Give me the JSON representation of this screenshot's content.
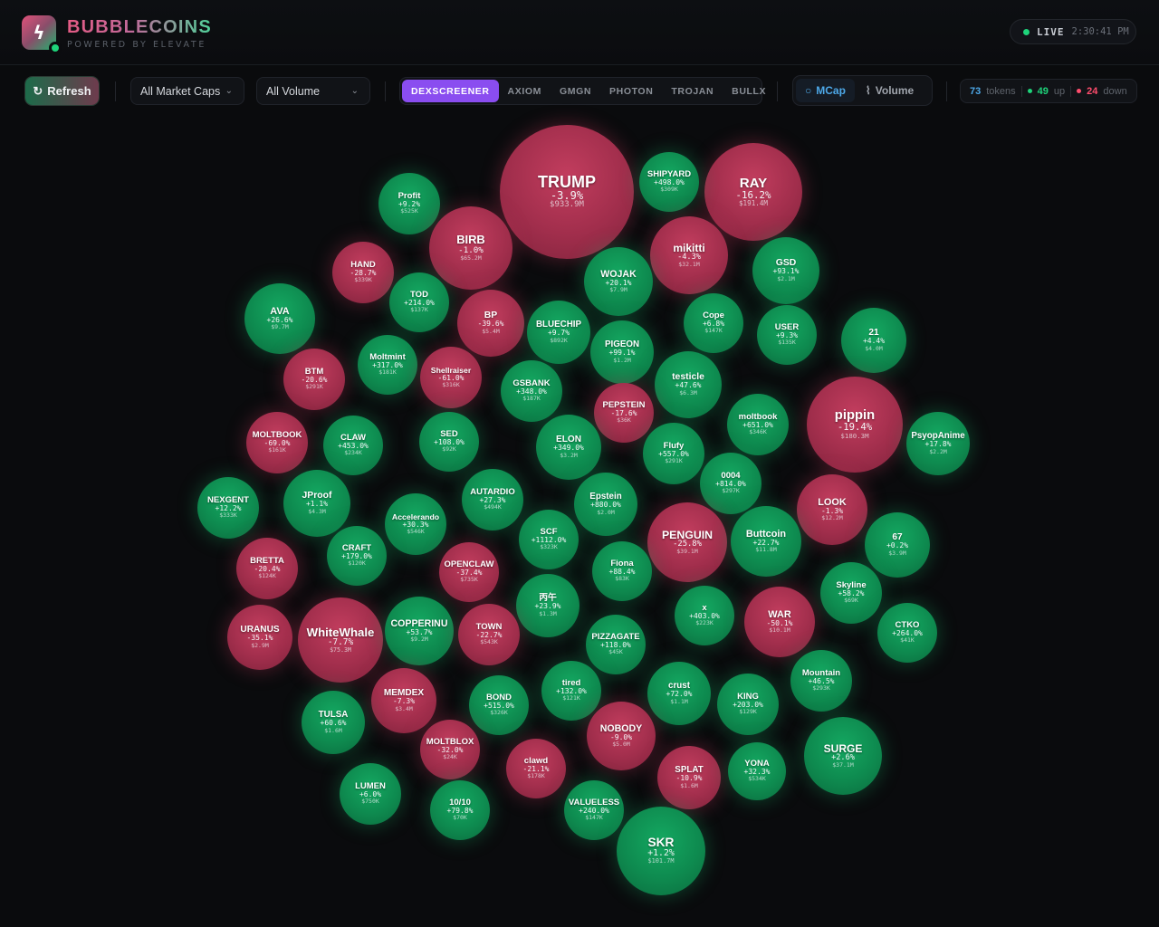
{
  "header": {
    "brand": "BUBBLECOINS",
    "powered_by": "POWERED BY ELEVATE",
    "live_label": "LIVE",
    "live_time": "2:30:41 PM"
  },
  "toolbar": {
    "refresh_label": "Refresh",
    "market_cap_filter": "All Market Caps",
    "volume_filter": "All Volume",
    "platforms": [
      {
        "label": "DEXSCREENER",
        "active": true
      },
      {
        "label": "AXIOM",
        "active": false
      },
      {
        "label": "GMGN",
        "active": false
      },
      {
        "label": "PHOTON",
        "active": false
      },
      {
        "label": "TROJAN",
        "active": false
      },
      {
        "label": "BULLX",
        "active": false
      }
    ],
    "metrics": [
      {
        "label": "MCap",
        "active": true,
        "icon": "circle-icon"
      },
      {
        "label": "Volume",
        "active": false,
        "icon": "pulse-icon"
      }
    ]
  },
  "stats": {
    "tokens": "73",
    "tokens_label": "tokens",
    "up": "49",
    "up_label": "up",
    "down": "24",
    "down_label": "down"
  },
  "colors": {
    "up": "#0e8a4f",
    "down": "#a12e4c",
    "accent_purple": "#8a4df0",
    "accent_blue": "#4da8e8",
    "stat_up": "#1ed37a",
    "stat_down": "#ff4d6d"
  },
  "bubbles": [
    {
      "symbol": "TRUMP",
      "change": "-3.9%",
      "mcap": "$933.9M",
      "dir": "down"
    },
    {
      "symbol": "RAY",
      "change": "-16.2%",
      "mcap": "$191.4M",
      "dir": "down"
    },
    {
      "symbol": "SHIPYARD",
      "change": "+498.0%",
      "mcap": "$309K",
      "dir": "up"
    },
    {
      "symbol": "Profit",
      "change": "+9.2%",
      "mcap": "$525K",
      "dir": "up"
    },
    {
      "symbol": "BIRB",
      "change": "-1.0%",
      "mcap": "$65.2M",
      "dir": "down"
    },
    {
      "symbol": "mikitti",
      "change": "-4.3%",
      "mcap": "$32.1M",
      "dir": "down"
    },
    {
      "symbol": "GSD",
      "change": "+93.1%",
      "mcap": "$2.1M",
      "dir": "up"
    },
    {
      "symbol": "HAND",
      "change": "-28.7%",
      "mcap": "$339K",
      "dir": "down"
    },
    {
      "symbol": "WOJAK",
      "change": "+20.1%",
      "mcap": "$7.9M",
      "dir": "up"
    },
    {
      "symbol": "TOD",
      "change": "+214.0%",
      "mcap": "$137K",
      "dir": "up"
    },
    {
      "symbol": "AVA",
      "change": "+26.6%",
      "mcap": "$9.7M",
      "dir": "up"
    },
    {
      "symbol": "BP",
      "change": "-39.6%",
      "mcap": "$5.4M",
      "dir": "down"
    },
    {
      "symbol": "BLUECHIP",
      "change": "+9.7%",
      "mcap": "$892K",
      "dir": "up"
    },
    {
      "symbol": "Cope",
      "change": "+6.8%",
      "mcap": "$147K",
      "dir": "up"
    },
    {
      "symbol": "USER",
      "change": "+9.3%",
      "mcap": "$135K",
      "dir": "up"
    },
    {
      "symbol": "21",
      "change": "+4.4%",
      "mcap": "$4.0M",
      "dir": "up"
    },
    {
      "symbol": "PIGEON",
      "change": "+99.1%",
      "mcap": "$1.2M",
      "dir": "up"
    },
    {
      "symbol": "Moltmint",
      "change": "+317.0%",
      "mcap": "$181K",
      "dir": "up"
    },
    {
      "symbol": "BTM",
      "change": "-20.6%",
      "mcap": "$291K",
      "dir": "down"
    },
    {
      "symbol": "Shellraiser",
      "change": "-61.0%",
      "mcap": "$316K",
      "dir": "down"
    },
    {
      "symbol": "testicle",
      "change": "+47.6%",
      "mcap": "$6.3M",
      "dir": "up"
    },
    {
      "symbol": "GSBANK",
      "change": "+348.0%",
      "mcap": "$187K",
      "dir": "up"
    },
    {
      "symbol": "PEPSTEIN",
      "change": "-17.6%",
      "mcap": "$36K",
      "dir": "down"
    },
    {
      "symbol": "pippin",
      "change": "-19.4%",
      "mcap": "$180.3M",
      "dir": "down"
    },
    {
      "symbol": "moltbook",
      "change": "+651.0%",
      "mcap": "$346K",
      "dir": "up"
    },
    {
      "symbol": "PsyopAnime",
      "change": "+17.8%",
      "mcap": "$2.2M",
      "dir": "up"
    },
    {
      "symbol": "MOLTBOOK",
      "change": "-69.0%",
      "mcap": "$161K",
      "dir": "down"
    },
    {
      "symbol": "CLAW",
      "change": "+453.0%",
      "mcap": "$234K",
      "dir": "up"
    },
    {
      "symbol": "SED",
      "change": "+108.0%",
      "mcap": "$92K",
      "dir": "up"
    },
    {
      "symbol": "ELON",
      "change": "+349.0%",
      "mcap": "$3.2M",
      "dir": "up"
    },
    {
      "symbol": "Flufy",
      "change": "+557.0%",
      "mcap": "$291K",
      "dir": "up"
    },
    {
      "symbol": "0004",
      "change": "+814.0%",
      "mcap": "$297K",
      "dir": "up"
    },
    {
      "symbol": "NEXGENT",
      "change": "+12.2%",
      "mcap": "$333K",
      "dir": "up"
    },
    {
      "symbol": "JProof",
      "change": "+1.1%",
      "mcap": "$4.3M",
      "dir": "up"
    },
    {
      "symbol": "AUTARDIO",
      "change": "+27.3%",
      "mcap": "$494K",
      "dir": "up"
    },
    {
      "symbol": "Epstein",
      "change": "+880.0%",
      "mcap": "$2.0M",
      "dir": "up"
    },
    {
      "symbol": "LOOK",
      "change": "-1.3%",
      "mcap": "$12.2M",
      "dir": "down"
    },
    {
      "symbol": "Accelerando",
      "change": "+30.3%",
      "mcap": "$546K",
      "dir": "up"
    },
    {
      "symbol": "SCF",
      "change": "+1112.0%",
      "mcap": "$323K",
      "dir": "up"
    },
    {
      "symbol": "PENGUIN",
      "change": "-25.8%",
      "mcap": "$39.1M",
      "dir": "down"
    },
    {
      "symbol": "Buttcoin",
      "change": "+22.7%",
      "mcap": "$11.8M",
      "dir": "up"
    },
    {
      "symbol": "67",
      "change": "+0.2%",
      "mcap": "$3.9M",
      "dir": "up"
    },
    {
      "symbol": "BRETTA",
      "change": "-20.4%",
      "mcap": "$124K",
      "dir": "down"
    },
    {
      "symbol": "CRAFT",
      "change": "+179.0%",
      "mcap": "$120K",
      "dir": "up"
    },
    {
      "symbol": "OPENCLAW",
      "change": "-37.4%",
      "mcap": "$735K",
      "dir": "down"
    },
    {
      "symbol": "Fiona",
      "change": "+88.4%",
      "mcap": "$83K",
      "dir": "up"
    },
    {
      "symbol": "Skyline",
      "change": "+58.2%",
      "mcap": "$69K",
      "dir": "up"
    },
    {
      "symbol": "丙午",
      "change": "+23.9%",
      "mcap": "$1.3M",
      "dir": "up"
    },
    {
      "symbol": "URANUS",
      "change": "-35.1%",
      "mcap": "$2.9M",
      "dir": "down"
    },
    {
      "symbol": "WhiteWhale",
      "change": "-7.7%",
      "mcap": "$75.3M",
      "dir": "down"
    },
    {
      "symbol": "COPPERINU",
      "change": "+53.7%",
      "mcap": "$9.2M",
      "dir": "up"
    },
    {
      "symbol": "TOWN",
      "change": "-22.7%",
      "mcap": "$543K",
      "dir": "down"
    },
    {
      "symbol": "PIZZAGATE",
      "change": "+118.0%",
      "mcap": "$45K",
      "dir": "up"
    },
    {
      "symbol": "x",
      "change": "+403.0%",
      "mcap": "$223K",
      "dir": "up"
    },
    {
      "symbol": "WAR",
      "change": "-50.1%",
      "mcap": "$10.1M",
      "dir": "down"
    },
    {
      "symbol": "CTKO",
      "change": "+264.0%",
      "mcap": "$41K",
      "dir": "up"
    },
    {
      "symbol": "Mountain",
      "change": "+46.5%",
      "mcap": "$293K",
      "dir": "up"
    },
    {
      "symbol": "MEMDEX",
      "change": "-7.3%",
      "mcap": "$3.4M",
      "dir": "down"
    },
    {
      "symbol": "tired",
      "change": "+132.0%",
      "mcap": "$121K",
      "dir": "up"
    },
    {
      "symbol": "crust",
      "change": "+72.0%",
      "mcap": "$1.1M",
      "dir": "up"
    },
    {
      "symbol": "KING",
      "change": "+203.0%",
      "mcap": "$129K",
      "dir": "up"
    },
    {
      "symbol": "TULSA",
      "change": "+60.6%",
      "mcap": "$1.6M",
      "dir": "up"
    },
    {
      "symbol": "BOND",
      "change": "+515.0%",
      "mcap": "$326K",
      "dir": "up"
    },
    {
      "symbol": "NOBODY",
      "change": "-9.0%",
      "mcap": "$5.0M",
      "dir": "down"
    },
    {
      "symbol": "MOLTBLOX",
      "change": "-32.0%",
      "mcap": "$24K",
      "dir": "down"
    },
    {
      "symbol": "SURGE",
      "change": "+2.6%",
      "mcap": "$37.1M",
      "dir": "up"
    },
    {
      "symbol": "clawd",
      "change": "-21.1%",
      "mcap": "$178K",
      "dir": "down"
    },
    {
      "symbol": "SPLAT",
      "change": "-10.9%",
      "mcap": "$1.6M",
      "dir": "down"
    },
    {
      "symbol": "YONA",
      "change": "+32.3%",
      "mcap": "$534K",
      "dir": "up"
    },
    {
      "symbol": "LUMEN",
      "change": "+6.0%",
      "mcap": "$750K",
      "dir": "up"
    },
    {
      "symbol": "10/10",
      "change": "+79.8%",
      "mcap": "$70K",
      "dir": "up"
    },
    {
      "symbol": "VALUELESS",
      "change": "+240.0%",
      "mcap": "$147K",
      "dir": "up"
    },
    {
      "symbol": "SKR",
      "change": "+1.2%",
      "mcap": "$101.7M",
      "dir": "up"
    }
  ]
}
